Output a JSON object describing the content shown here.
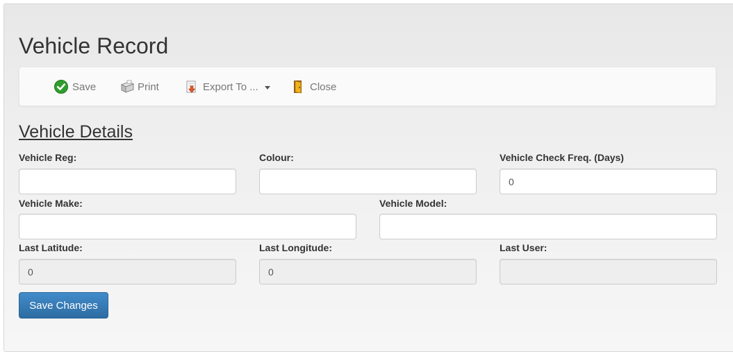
{
  "page": {
    "title": "Vehicle Record"
  },
  "toolbar": {
    "save_label": "Save",
    "print_label": "Print",
    "export_label": "Export To ...",
    "close_label": "Close"
  },
  "section": {
    "title": "Vehicle Details"
  },
  "fields": {
    "vehicle_reg": {
      "label": "Vehicle Reg:",
      "value": ""
    },
    "colour": {
      "label": "Colour:",
      "value": ""
    },
    "check_freq": {
      "label": "Vehicle Check Freq. (Days)",
      "value": "0"
    },
    "make": {
      "label": "Vehicle Make:",
      "value": ""
    },
    "model": {
      "label": "Vehicle Model:",
      "value": ""
    },
    "last_latitude": {
      "label": "Last Latitude:",
      "value": "0"
    },
    "last_longitude": {
      "label": "Last Longitude:",
      "value": "0"
    },
    "last_user": {
      "label": "Last User:",
      "value": ""
    }
  },
  "actions": {
    "save_changes_label": "Save Changes"
  },
  "icons": {
    "save": "check-circle-icon",
    "print": "printer-icon",
    "export": "export-document-icon",
    "close": "door-exit-icon"
  },
  "colors": {
    "primary_button": "#337ab7",
    "save_icon": "#2e9e2e"
  }
}
